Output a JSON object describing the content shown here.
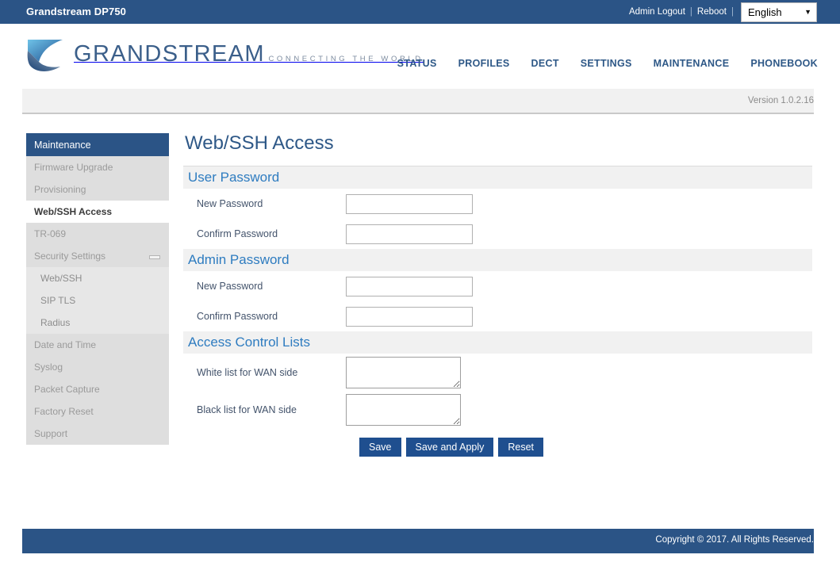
{
  "topbar": {
    "device_title": "Grandstream DP750",
    "admin_logout": "Admin Logout",
    "separator": "|",
    "reboot": "Reboot",
    "language_selected": "English",
    "language_options": [
      "English"
    ]
  },
  "brand": {
    "name": "GRANDSTREAM",
    "tagline": "CONNECTING THE WORLD",
    "logo_icon": "grandstream-swoosh-logo",
    "brand_color": "#3b5f8a"
  },
  "nav": {
    "items": [
      {
        "label": "STATUS"
      },
      {
        "label": "PROFILES"
      },
      {
        "label": "DECT"
      },
      {
        "label": "SETTINGS"
      },
      {
        "label": "MAINTENANCE"
      },
      {
        "label": "PHONEBOOK"
      }
    ]
  },
  "version_bar": {
    "text": "Version 1.0.2.16"
  },
  "sidebar": {
    "header": "Maintenance",
    "items": [
      {
        "label": "Firmware Upgrade",
        "style": "normal",
        "active": false
      },
      {
        "label": "Provisioning",
        "style": "normal",
        "active": false
      },
      {
        "label": "Web/SSH Access",
        "style": "normal",
        "active": true
      },
      {
        "label": "TR-069",
        "style": "normal",
        "active": false
      },
      {
        "label": "Security Settings",
        "style": "normal",
        "active": false,
        "collapse_icon": "minus-icon"
      },
      {
        "label": "Web/SSH",
        "style": "sub",
        "active": false
      },
      {
        "label": "SIP TLS",
        "style": "sub",
        "active": false
      },
      {
        "label": "Radius",
        "style": "sub",
        "active": false
      },
      {
        "label": "Date and Time",
        "style": "normal",
        "active": false
      },
      {
        "label": "Syslog",
        "style": "normal",
        "active": false
      },
      {
        "label": "Packet Capture",
        "style": "normal",
        "active": false
      },
      {
        "label": "Factory Reset",
        "style": "normal",
        "active": false
      },
      {
        "label": "Support",
        "style": "normal",
        "active": false
      }
    ]
  },
  "main": {
    "page_title": "Web/SSH Access",
    "sections": [
      {
        "heading": "User Password",
        "fields": [
          {
            "label": "New Password",
            "value": "",
            "placeholder": "",
            "type": "input"
          },
          {
            "label": "Confirm Password",
            "value": "",
            "placeholder": "",
            "type": "input"
          }
        ]
      },
      {
        "heading": "Admin Password",
        "fields": [
          {
            "label": "New Password",
            "value": "",
            "placeholder": "",
            "type": "input"
          },
          {
            "label": "Confirm Password",
            "value": "",
            "placeholder": "",
            "type": "input"
          }
        ]
      },
      {
        "heading": "Access Control Lists",
        "fields": [
          {
            "label": "White list for WAN side",
            "value": "",
            "placeholder": "",
            "type": "textarea"
          },
          {
            "label": "Black list for WAN side",
            "value": "",
            "placeholder": "",
            "type": "textarea"
          }
        ]
      }
    ],
    "buttons": [
      {
        "label": "Save"
      },
      {
        "label": "Save and Apply"
      },
      {
        "label": "Reset"
      }
    ]
  },
  "footer": {
    "copyright": "Copyright © 2017. All Rights Reserved."
  }
}
